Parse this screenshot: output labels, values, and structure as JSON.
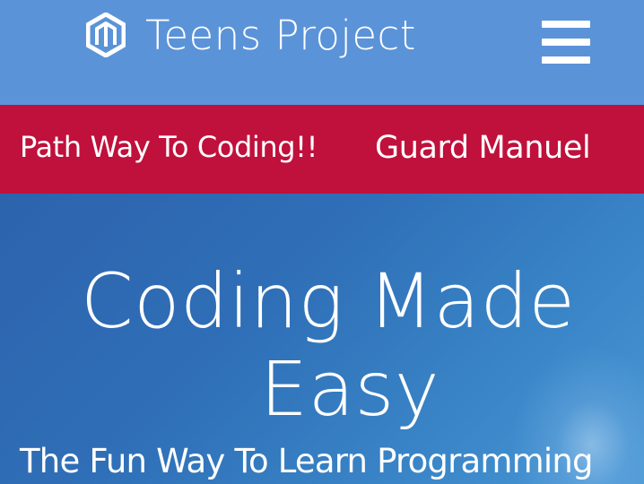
{
  "header": {
    "brand_title": "Teens Project",
    "logo_icon": "hexagon-m-logo-icon",
    "menu_icon": "hamburger-menu-icon"
  },
  "banner": {
    "left_text": "Path Way To Coding!!",
    "right_text": "Guard Manuel"
  },
  "hero": {
    "title_line1": "Coding Made",
    "title_line2": "Easy",
    "subtitle": "The Fun Way To Learn Programming"
  },
  "colors": {
    "header_bg": "#5b93d8",
    "banner_bg": "#c0103c",
    "hero_bg": "#2f6fb7",
    "text": "#ffffff"
  }
}
